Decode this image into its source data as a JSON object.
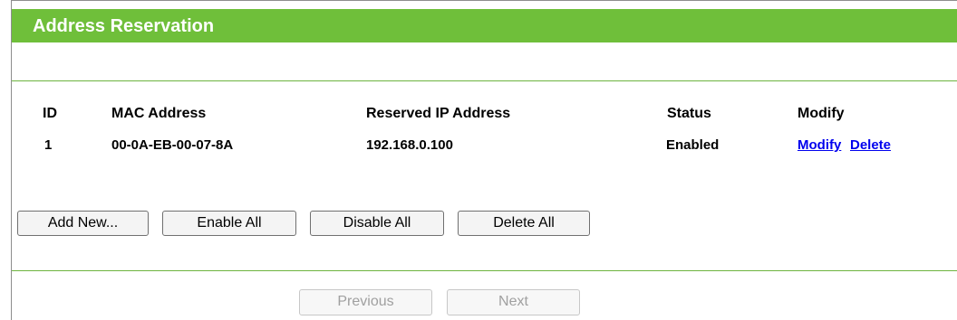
{
  "header": {
    "title": "Address Reservation"
  },
  "table": {
    "columns": [
      "ID",
      "MAC Address",
      "Reserved IP Address",
      "Status",
      "Modify"
    ],
    "rows": [
      {
        "id": "1",
        "mac": "00-0A-EB-00-07-8A",
        "ip": "192.168.0.100",
        "status": "Enabled",
        "modify_label": "Modify",
        "delete_label": "Delete"
      }
    ]
  },
  "actions": {
    "add_new": "Add New...",
    "enable_all": "Enable All",
    "disable_all": "Disable All",
    "delete_all": "Delete All"
  },
  "pagination": {
    "previous": "Previous",
    "next": "Next",
    "previous_enabled": false,
    "next_enabled": false
  },
  "colors": {
    "title_bar": "#6fbf3a",
    "divider": "#6db33f",
    "link": "#0000ee"
  }
}
